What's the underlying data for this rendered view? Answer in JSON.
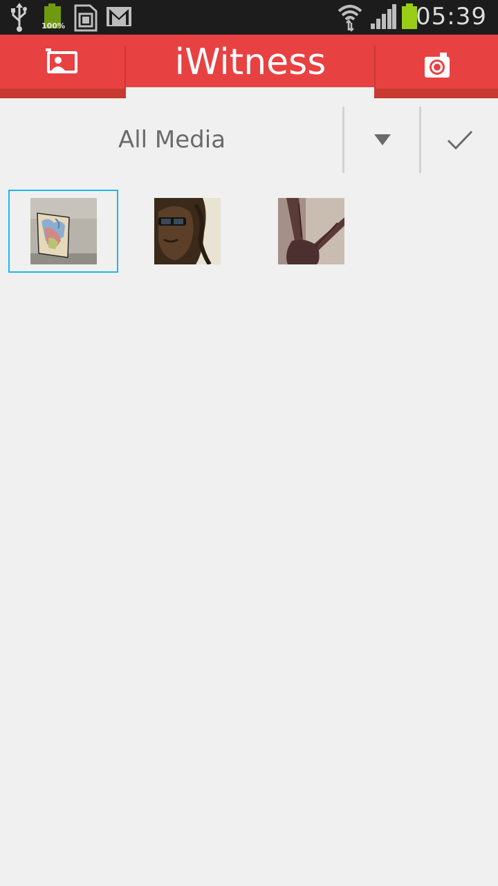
{
  "status_bar": {
    "time": "05:39",
    "battery_small_label": "100%",
    "icons": [
      "usb-icon",
      "battery-full-icon",
      "sd-card-icon",
      "gmail-icon",
      "wifi-icon",
      "signal-icon",
      "battery-icon"
    ]
  },
  "action_bar": {
    "title": "iWitness",
    "left_tab_icon": "gallery-icon",
    "right_tab_icon": "camera-icon"
  },
  "filter": {
    "selected": "All Media",
    "dropdown_icon": "dropdown-arrow-icon",
    "confirm_icon": "checkmark-icon"
  },
  "media": [
    {
      "name": "map-photo",
      "selected": true
    },
    {
      "name": "face-photo",
      "selected": false
    },
    {
      "name": "hand-photo",
      "selected": false
    }
  ],
  "colors": {
    "accent": "#e84142",
    "accent_dark": "#c8392f",
    "selection": "#1fb6ea",
    "background": "#eff0ef"
  }
}
